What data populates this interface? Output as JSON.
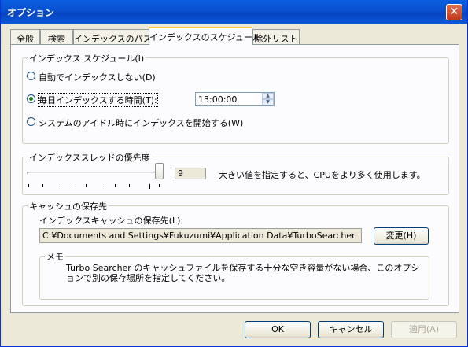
{
  "window": {
    "title": "オプション",
    "close_glyph": "✕"
  },
  "tabs": [
    {
      "label": "全般"
    },
    {
      "label": "検索"
    },
    {
      "label": "インデックスのパス"
    },
    {
      "label": "インデックスのスケジュール"
    },
    {
      "label": "除外リスト"
    }
  ],
  "schedule": {
    "legend": "インデックス スケジュール(I)",
    "options": [
      {
        "label": "自動でインデックスしない(D)",
        "checked": false
      },
      {
        "label": "毎日インデックスする時間(T):",
        "checked": true
      },
      {
        "label": "システムのアイドル時にインデックスを開始する(W)",
        "checked": false
      }
    ],
    "time_value": "13:00:00"
  },
  "priority": {
    "legend": "インデックススレッドの優先度",
    "value": "9",
    "level": 9,
    "hint": "大きい値を指定すると、CPUをより多く使用します。"
  },
  "cache": {
    "legend": "キャッシュの保存先",
    "label": "インデックスキャッシュの保存先(L):",
    "path": "C:¥Documents and Settings¥Fukuzumi¥Application Data¥TurboSearcher",
    "change_button": "変更(H)",
    "memo_legend": "メモ",
    "memo_text": "Turbo Searcher のキャッシュファイルを保存する十分な空き容量がない場合、このオプションで別の保存場所を指定してください。"
  },
  "footer": {
    "ok": "OK",
    "cancel": "キャンセル",
    "apply": "適用(A)"
  }
}
